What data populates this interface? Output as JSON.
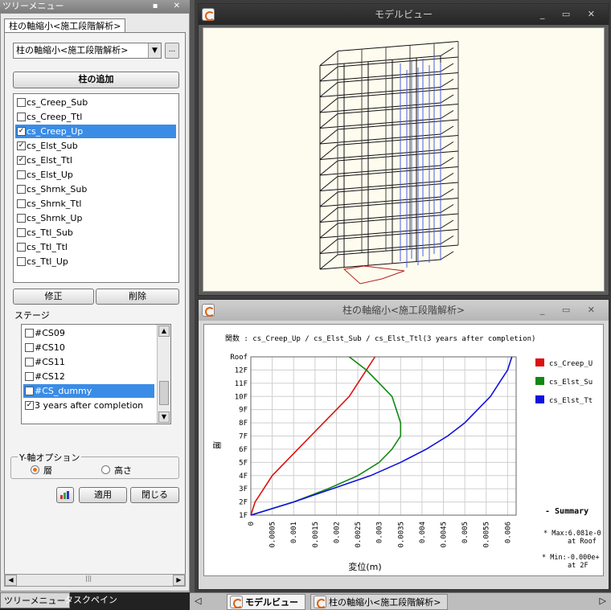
{
  "tree_panel": {
    "title": "ツリーメニュー",
    "header_buttons": "▪ ✕",
    "tab_label": "柱の軸縮小<施工段階解析>",
    "combo_value": "柱の軸縮小<施工段階解析>",
    "combo_arrow": "▼",
    "combo_more": "...",
    "add_column_label": "柱の追加",
    "functions": [
      {
        "label": "cs_Creep_Sub",
        "checked": false,
        "selected": false
      },
      {
        "label": "cs_Creep_Ttl",
        "checked": false,
        "selected": false
      },
      {
        "label": "cs_Creep_Up",
        "checked": true,
        "selected": true
      },
      {
        "label": "cs_Elst_Sub",
        "checked": true,
        "selected": false
      },
      {
        "label": "cs_Elst_Ttl",
        "checked": true,
        "selected": false
      },
      {
        "label": "cs_Elst_Up",
        "checked": false,
        "selected": false
      },
      {
        "label": "cs_Shrnk_Sub",
        "checked": false,
        "selected": false
      },
      {
        "label": "cs_Shrnk_Ttl",
        "checked": false,
        "selected": false
      },
      {
        "label": "cs_Shrnk_Up",
        "checked": false,
        "selected": false
      },
      {
        "label": "cs_Ttl_Sub",
        "checked": false,
        "selected": false
      },
      {
        "label": "cs_Ttl_Ttl",
        "checked": false,
        "selected": false
      },
      {
        "label": "cs_Ttl_Up",
        "checked": false,
        "selected": false
      }
    ],
    "modify_label": "修正",
    "delete_label": "削除",
    "stage_label": "ステージ",
    "stages": [
      {
        "label": "#CS09",
        "checked": false,
        "selected": false
      },
      {
        "label": "#CS10",
        "checked": false,
        "selected": false
      },
      {
        "label": "#CS11",
        "checked": false,
        "selected": false
      },
      {
        "label": "#CS12",
        "checked": false,
        "selected": false
      },
      {
        "label": "#CS_dummy",
        "checked": false,
        "selected": true
      },
      {
        "label": "3 years after completion",
        "checked": true,
        "selected": false
      }
    ],
    "yaxis_option_label": "Y-軸オプション",
    "yaxis_options": [
      {
        "label": "層",
        "on": true
      },
      {
        "label": "高さ",
        "on": false
      }
    ],
    "apply_label": "適用",
    "close_label": "閉じる",
    "scroll_grip": "|||",
    "bottom_tabs": [
      "ツリーメニュー",
      "タスクペイン"
    ]
  },
  "model_view": {
    "title": "モデルビュー"
  },
  "graph_window": {
    "title": "柱の軸縮小<施工段階解析>"
  },
  "window_buttons": "_ ▭ ✕",
  "bottom_bar": {
    "left_arrow": "◁",
    "right_arrow": "▷",
    "tabs": [
      "モデルビュー",
      "柱の軸縮小<施工段階解析>"
    ]
  },
  "colors": {
    "creep": "#dd1111",
    "elst_sub": "#118811",
    "elst_ttl": "#1111dd",
    "selection": "#3b8ce6"
  },
  "chart_data": {
    "type": "line",
    "title": "関数 : cs_Creep_Up / cs_Elst_Sub / cs_Elst_Ttl(3 years after completion)",
    "xlabel": "変位(m)",
    "ylabel": "層",
    "xlim": [
      0,
      0.0062
    ],
    "x_ticks": [
      "0",
      "0.0005",
      "0.001",
      "0.0015",
      "0.002",
      "0.0025",
      "0.003",
      "0.0035",
      "0.004",
      "0.0045",
      "0.005",
      "0.0055",
      "0.006"
    ],
    "categories": [
      "1F",
      "2F",
      "3F",
      "4F",
      "5F",
      "6F",
      "7F",
      "8F",
      "9F",
      "10F",
      "11F",
      "12F",
      "Roof"
    ],
    "legend_entries": [
      "cs_Creep_U",
      "cs_Elst_Su",
      "cs_Elst_Tt"
    ],
    "legend_position": "right",
    "grid": true,
    "series": [
      {
        "values": [
          0.0,
          0.0001,
          0.0003,
          0.0005,
          0.0008,
          0.0011,
          0.0014,
          0.0017,
          0.002,
          0.0023,
          0.0025,
          0.0027,
          0.0029
        ]
      },
      {
        "values": [
          0.0,
          0.001,
          0.0018,
          0.0025,
          0.003,
          0.0033,
          0.0035,
          0.0035,
          0.0034,
          0.0033,
          0.003,
          0.0027,
          0.0023
        ]
      },
      {
        "values": [
          0.0,
          0.001,
          0.0019,
          0.0028,
          0.0035,
          0.0041,
          0.0046,
          0.005,
          0.0053,
          0.0056,
          0.0058,
          0.006,
          0.0061
        ]
      }
    ],
    "summary": {
      "heading": "- Summary",
      "max_line1": "* Max:6.081e-0",
      "max_line2": "at Roof",
      "min_line1": "* Min:-0.000e+",
      "min_line2": "at 2F"
    }
  }
}
